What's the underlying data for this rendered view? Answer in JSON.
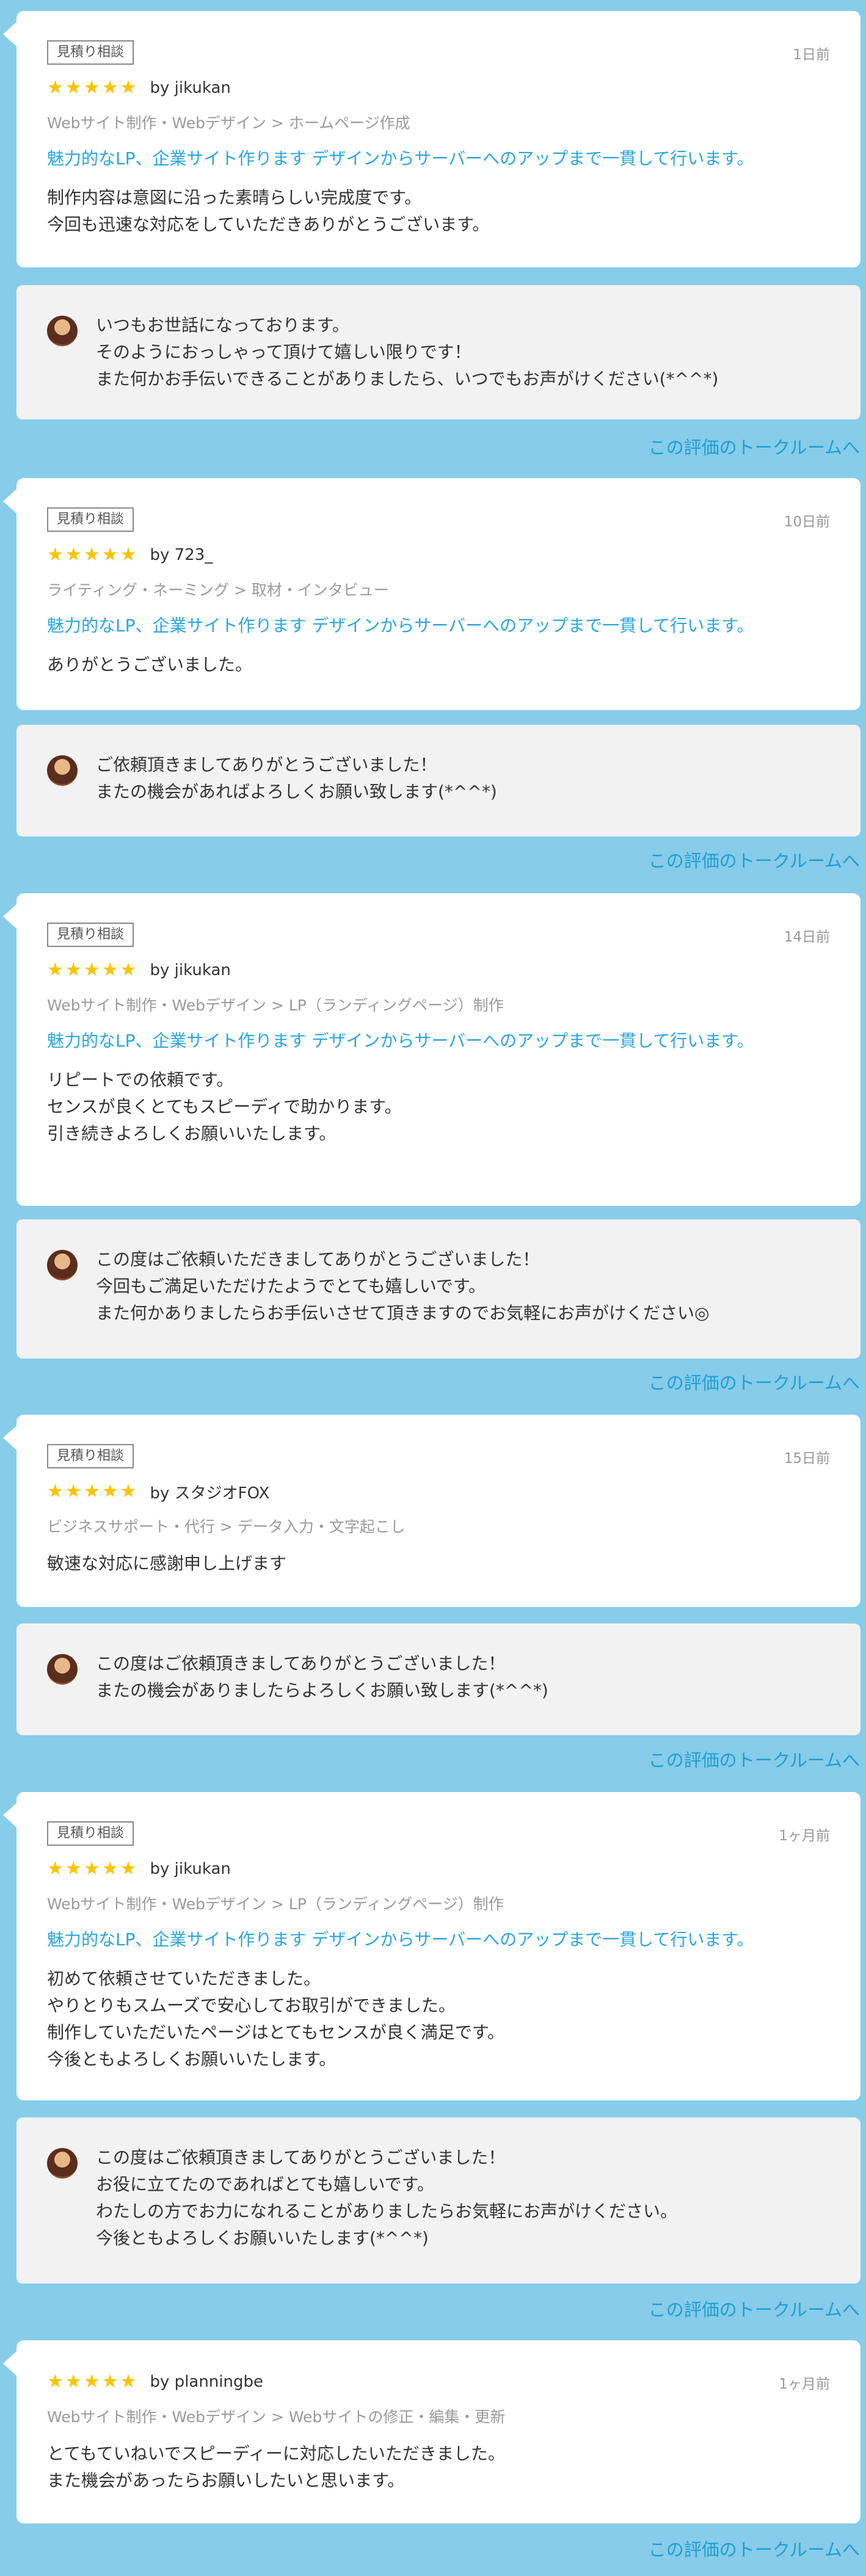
{
  "reviews": [
    {
      "badge": "見積り相談",
      "date": "1日前",
      "stars": 5,
      "reviewer": "by jikukan",
      "category": "Webサイト制作・Webデザイン > ホームページ作成",
      "service_title": "魅力的なLP、企業サイト作ります デザインからサーバーへのアップまで一貫して行います。",
      "text": "制作内容は意図に沿った素晴らしい完成度です。\n今回も迅速な対応をしていただきありがとうございます。",
      "reply": "いつもお世話になっております。\nそのようにおっしゃって頂けて嬉しい限りです！\nまた何かお手伝いできることがありましたら、いつでもお声がけください(*^^*)",
      "talk_link": "この評価のトークルームへ"
    },
    {
      "badge": "見積り相談",
      "date": "10日前",
      "stars": 5,
      "reviewer": "by 723_",
      "category": "ライティング・ネーミング > 取材・インタビュー",
      "service_title": "魅力的なLP、企業サイト作ります デザインからサーバーへのアップまで一貫して行います。",
      "text": "ありがとうございました。",
      "reply": "ご依頼頂きましてありがとうございました！\nまたの機会があればよろしくお願い致します(*^^*)",
      "talk_link": "この評価のトークルームへ"
    },
    {
      "badge": "見積り相談",
      "date": "14日前",
      "stars": 5,
      "reviewer": "by jikukan",
      "category": "Webサイト制作・Webデザイン > LP（ランディングページ）制作",
      "service_title": "魅力的なLP、企業サイト作ります デザインからサーバーへのアップまで一貫して行います。",
      "text": "リピートでの依頼です。\nセンスが良くとてもスピーディで助かります。\n引き続きよろしくお願いいたします。",
      "reply": "この度はご依頼いただきましてありがとうございました！\n今回もご満足いただけたようでとても嬉しいです。\nまた何かありましたらお手伝いさせて頂きますのでお気軽にお声がけください◎",
      "talk_link": "この評価のトークルームへ"
    },
    {
      "badge": "見積り相談",
      "date": "15日前",
      "stars": 5,
      "reviewer": "by スタジオFOX",
      "category": "ビジネスサポート・代行 > データ入力・文字起こし",
      "service_title": "",
      "text": "敏速な対応に感謝申し上げます",
      "reply": "この度はご依頼頂きましてありがとうございました！\nまたの機会がありましたらよろしくお願い致します(*^^*)",
      "talk_link": "この評価のトークルームへ"
    },
    {
      "badge": "見積り相談",
      "date": "1ヶ月前",
      "stars": 5,
      "reviewer": "by jikukan",
      "category": "Webサイト制作・Webデザイン > LP（ランディングページ）制作",
      "service_title": "魅力的なLP、企業サイト作ります デザインからサーバーへのアップまで一貫して行います。",
      "text": "初めて依頼させていただきました。\nやりとりもスムーズで安心してお取引ができました。\n制作していただいたページはとてもセンスが良く満足です。\n今後ともよろしくお願いいたします。",
      "reply": "この度はご依頼頂きましてありがとうございました！\nお役に立てたのであればとても嬉しいです。\nわたしの方でお力になれることがありましたらお気軽にお声がけください。\n今後ともよろしくお願いいたします(*^^*)",
      "talk_link": "この評価のトークルームへ"
    },
    {
      "badge": "",
      "date": "1ヶ月前",
      "stars": 5,
      "reviewer": "by planningbe",
      "category": "Webサイト制作・Webデザイン > Webサイトの修正・編集・更新",
      "service_title": "",
      "text": "とてもていねいでスピーディーに対応したいただきました。\nまた機会があったらお願いしたいと思います。",
      "reply": "",
      "talk_link": "この評価のトークルームへ"
    }
  ]
}
